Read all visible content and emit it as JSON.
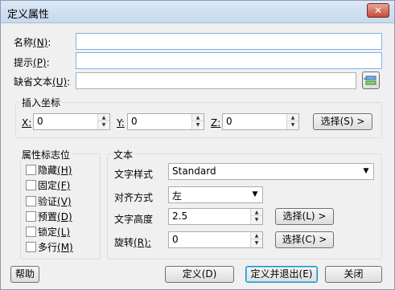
{
  "window": {
    "title": "定义属性",
    "close_label": "✕"
  },
  "fields": {
    "name_label": "名称",
    "name_key": "(N)",
    "name_value": "",
    "prompt_label": "提示",
    "prompt_key": "(P)",
    "prompt_value": "",
    "default_label": "缺省文本",
    "default_key": "(U)",
    "default_value": ""
  },
  "insert": {
    "title": "插入坐标",
    "x_label": "X",
    "x_value": "0",
    "y_label": "Y",
    "y_value": "0",
    "z_label": "Z",
    "z_value": "0",
    "select_label": "选择(S) >"
  },
  "flags": {
    "title": "属性标志位",
    "items": [
      {
        "label": "隐藏",
        "key": "(H)",
        "checked": false
      },
      {
        "label": "固定",
        "key": "(F)",
        "checked": false
      },
      {
        "label": "验证",
        "key": "(V)",
        "checked": false
      },
      {
        "label": "预置",
        "key": "(D)",
        "checked": false
      },
      {
        "label": "锁定",
        "key": "(L)",
        "checked": false
      },
      {
        "label": "多行",
        "key": "(M)",
        "checked": false
      }
    ]
  },
  "text": {
    "title": "文本",
    "style_label": "文字样式",
    "style_value": "Standard",
    "align_label": "对齐方式",
    "align_value": "左",
    "height_label": "文字高度",
    "height_value": "2.5",
    "height_select": "选择(L) >",
    "rotation_label": "旋转",
    "rotation_key": "(R):",
    "rotation_value": "0",
    "rotation_select": "选择(C) >"
  },
  "buttons": {
    "help": "帮助",
    "define": "定义(D)",
    "define_exit": "定义并退出(E)",
    "close": "关闭"
  },
  "colors": {
    "default_button_border": "#3c7fb1",
    "focus_field_border": "#7eb4ea"
  },
  "icons": {
    "browse": "field-insert-icon",
    "spin_up": "up-arrow-icon",
    "spin_down": "down-arrow-icon",
    "dropdown": "chevron-down-icon"
  }
}
